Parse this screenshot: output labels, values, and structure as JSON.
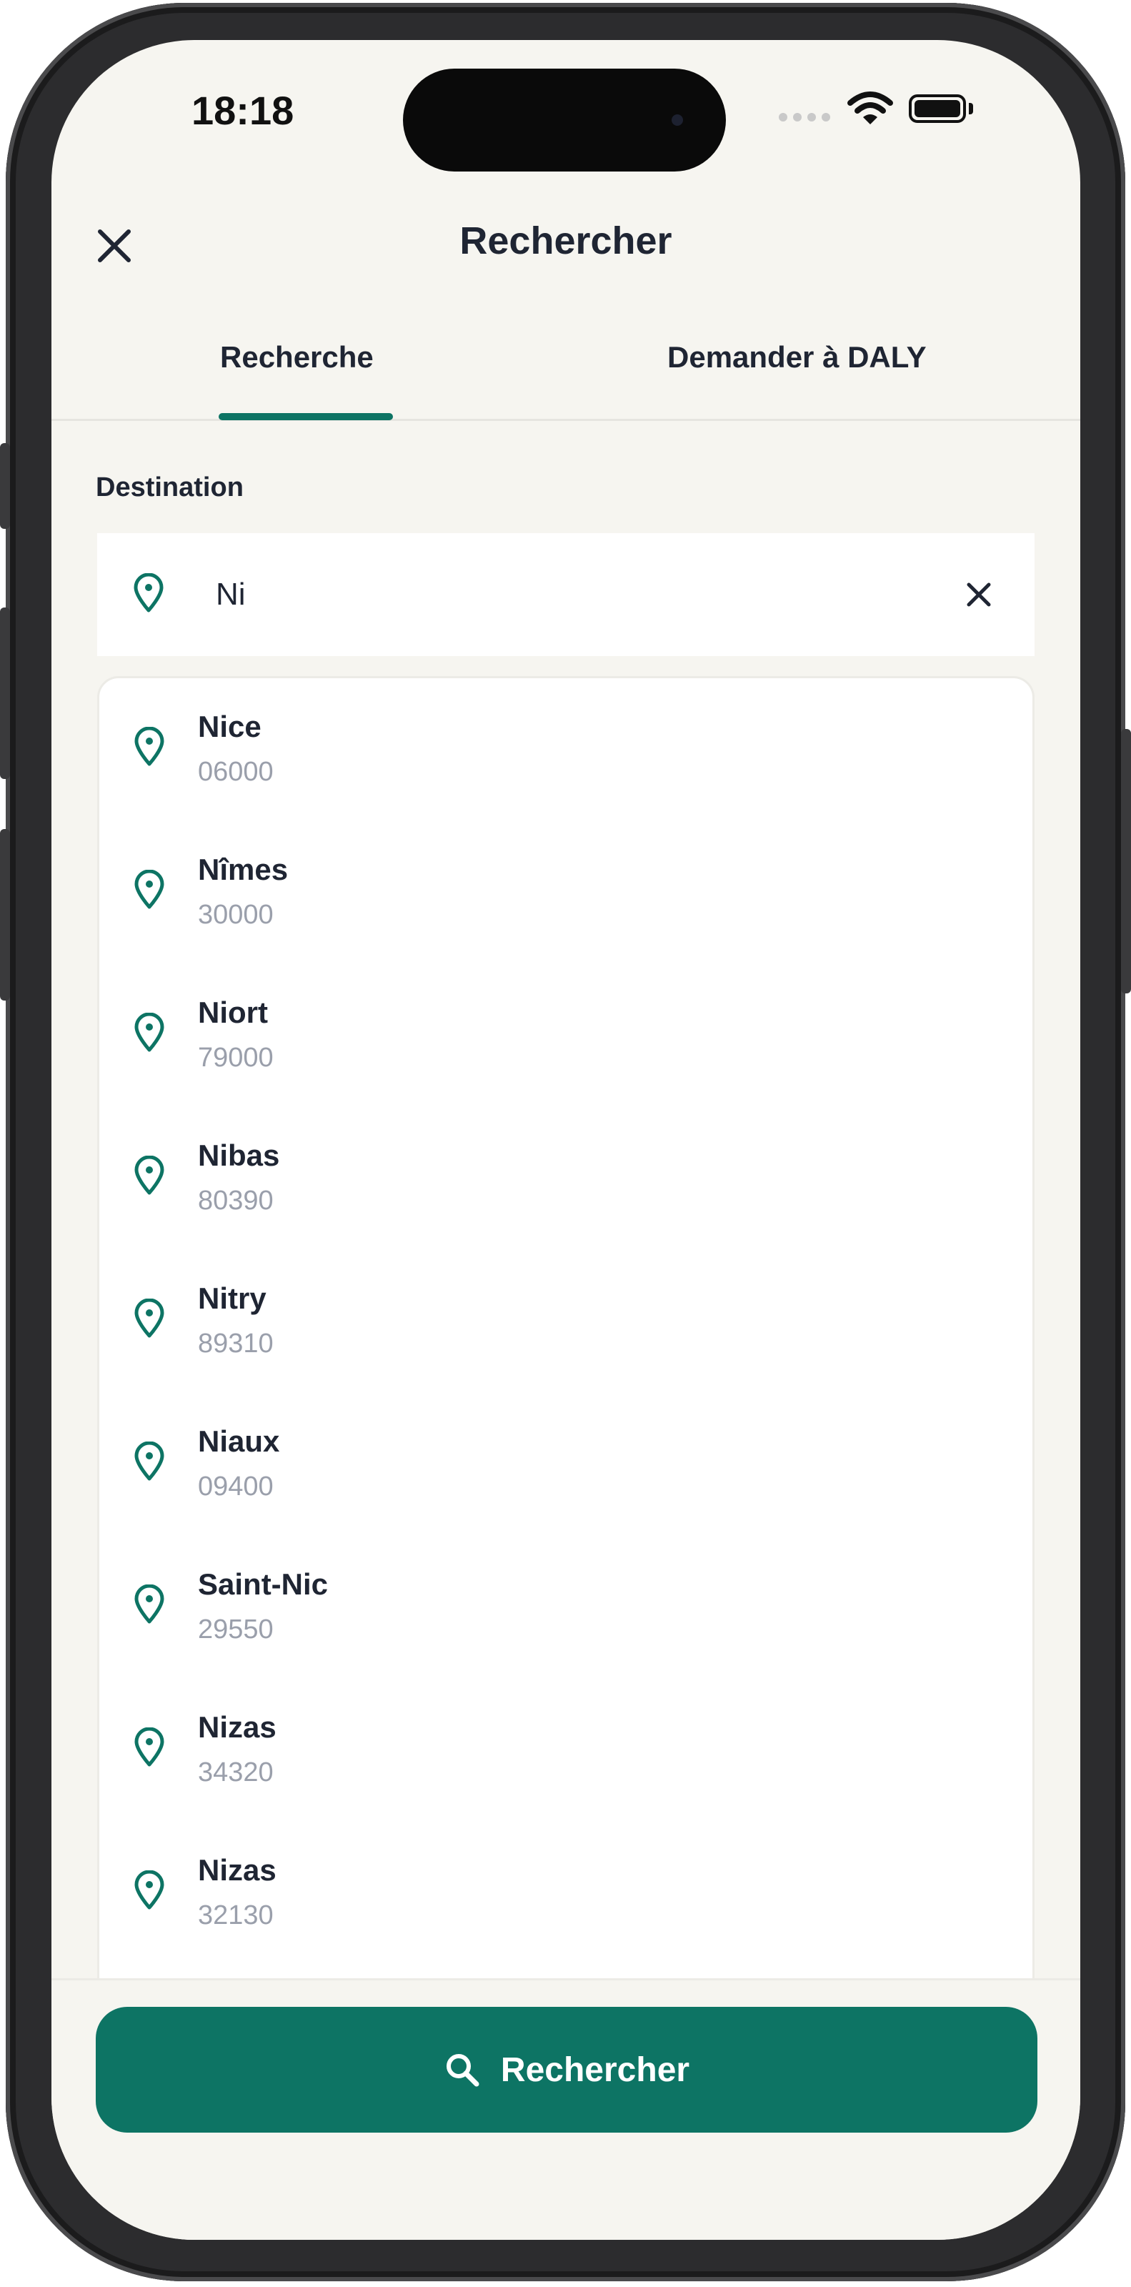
{
  "status_bar": {
    "time": "18:18"
  },
  "header": {
    "title": "Rechercher"
  },
  "tabs": [
    {
      "label": "Recherche",
      "active": true
    },
    {
      "label": "Demander à DALY",
      "active": false
    }
  ],
  "destination": {
    "label": "Destination",
    "value": "Ni"
  },
  "results": [
    {
      "name": "Nice",
      "code": "06000"
    },
    {
      "name": "Nîmes",
      "code": "30000"
    },
    {
      "name": "Niort",
      "code": "79000"
    },
    {
      "name": "Nibas",
      "code": "80390"
    },
    {
      "name": "Nitry",
      "code": "89310"
    },
    {
      "name": "Niaux",
      "code": "09400"
    },
    {
      "name": "Saint-Nic",
      "code": "29550"
    },
    {
      "name": "Nizas",
      "code": "34320"
    },
    {
      "name": "Nizas",
      "code": "32130"
    }
  ],
  "search_button": {
    "label": "Rechercher",
    "icon": "search-icon"
  },
  "icons": {
    "close": "close-icon",
    "pin": "map-pin-icon",
    "clear": "clear-icon"
  },
  "colors": {
    "accent": "#0d7464",
    "background": "#f6f5f0",
    "text": "#1f2533",
    "muted": "#9a9fab"
  }
}
